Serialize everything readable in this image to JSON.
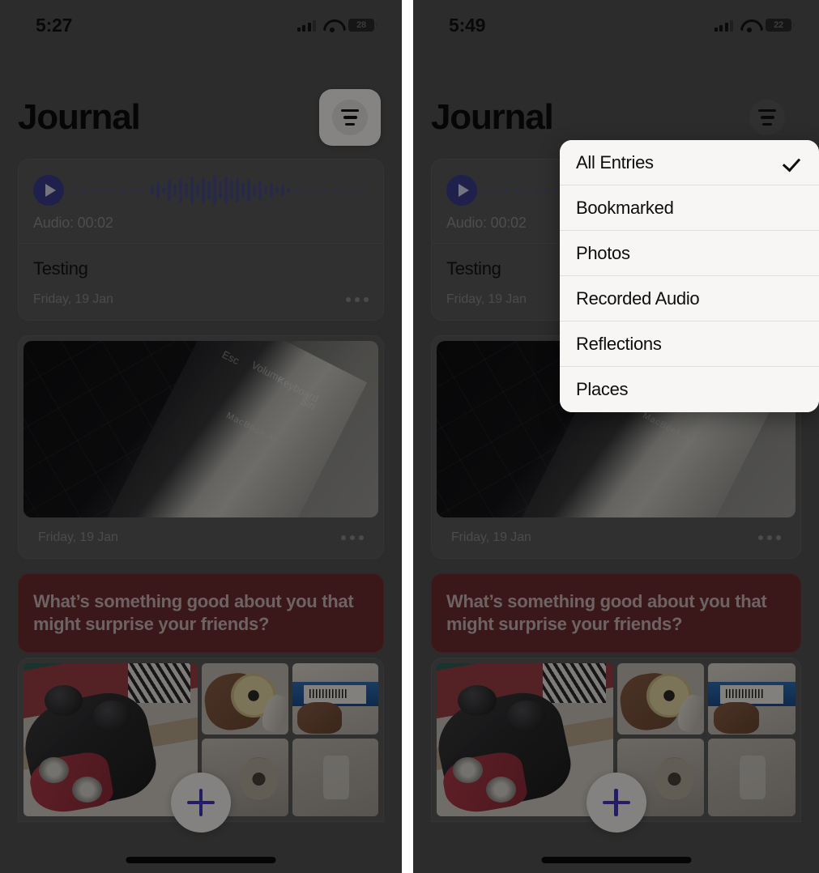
{
  "panels": {
    "left": {
      "status": {
        "time": "5:27",
        "battery": "28",
        "signal_icon": "cellular-signal-icon",
        "wifi_icon": "wifi-icon",
        "battery_icon": "battery-icon"
      },
      "header": {
        "title": "Journal",
        "filter_icon": "filter-lines-icon"
      },
      "menu_open": false
    },
    "right": {
      "status": {
        "time": "5:49",
        "battery": "22",
        "signal_icon": "cellular-signal-icon",
        "wifi_icon": "wifi-icon",
        "battery_icon": "battery-icon"
      },
      "header": {
        "title": "Journal",
        "filter_icon": "filter-lines-icon"
      },
      "menu_open": true
    }
  },
  "filter_menu": {
    "items": [
      {
        "label": "All Entries",
        "selected": true
      },
      {
        "label": "Bookmarked",
        "selected": false
      },
      {
        "label": "Photos",
        "selected": false
      },
      {
        "label": "Recorded Audio",
        "selected": false
      },
      {
        "label": "Reflections",
        "selected": false
      },
      {
        "label": "Places",
        "selected": false
      }
    ],
    "check_icon": "checkmark-icon"
  },
  "feed": {
    "audio_entry": {
      "play_icon": "play-circle-icon",
      "duration_label": "Audio: 00:02",
      "title": "Testing",
      "date": "Friday, 19 Jan",
      "more_icon": "ellipsis-icon"
    },
    "photo_entry": {
      "image_alt": "macbook-air-keyboard-photo",
      "date": "Friday, 19 Jan",
      "more_icon": "ellipsis-icon"
    },
    "reflection_prompt": {
      "text": "What’s something good about you that might surprise your friends?"
    },
    "photo_grid": {
      "tiles": [
        "game-controller-on-rug-photo",
        "hand-holding-tape-roll-photo",
        "hand-holding-blue-box-photo",
        "tape-roll-closeup-photo",
        "blurred-object-photo"
      ]
    },
    "add_button": {
      "icon": "plus-icon",
      "label": ""
    }
  },
  "colors": {
    "accent_purple": "#4436b8",
    "audio_wave": "#4b4b87",
    "prompt_bg": "#6b2b2d",
    "menu_bg": "#f5f4f3",
    "screen_bg": "#525252"
  },
  "wave_heights": [
    12,
    20,
    8,
    26,
    14,
    30,
    18,
    34,
    16,
    32,
    22,
    36,
    20,
    34,
    24,
    30,
    18,
    28,
    14,
    24,
    10,
    18,
    8,
    14,
    6
  ]
}
